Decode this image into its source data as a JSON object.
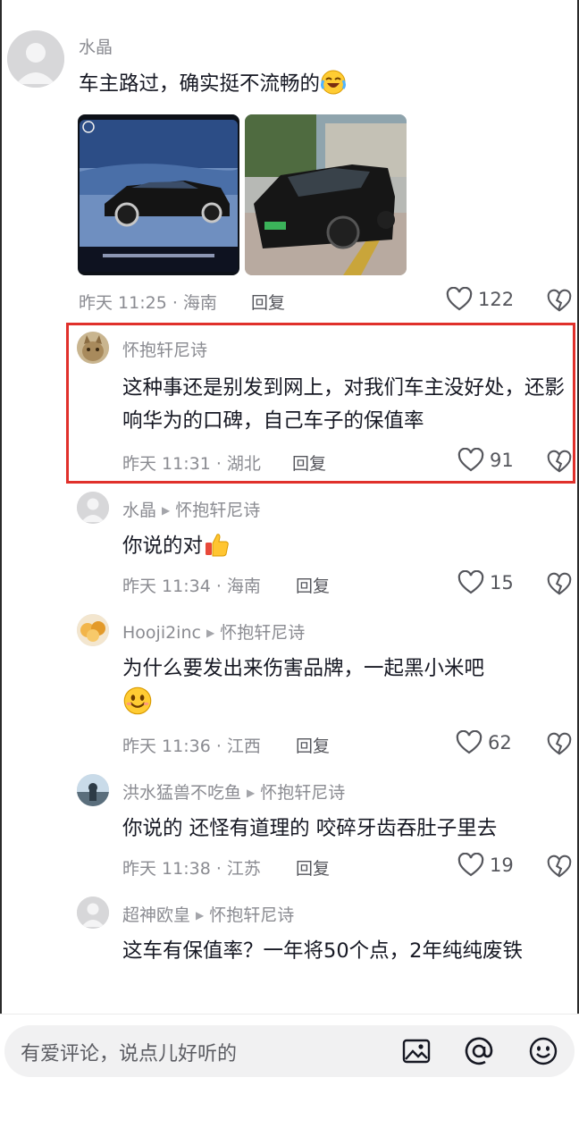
{
  "comments": [
    {
      "user": "水晶",
      "text": "车主路过，确实挺不流畅的",
      "meta": "昨天 11:25 · 海南",
      "reply": "回复",
      "likes": "122"
    },
    {
      "user": "怀抱轩尼诗",
      "text": "这种事还是别发到网上，对我们车主没好处，还影响华为的口碑，自己车子的保值率",
      "meta": "昨天 11:31 · 湖北",
      "reply": "回复",
      "likes": "91"
    },
    {
      "user": "水晶",
      "reply_to": "怀抱轩尼诗",
      "text": "你说的对",
      "meta": "昨天 11:34 · 海南",
      "reply": "回复",
      "likes": "15"
    },
    {
      "user": "Hooji2inc",
      "reply_to": "怀抱轩尼诗",
      "text": "为什么要发出来伤害品牌，一起黑小米吧",
      "meta": "昨天 11:36 · 江西",
      "reply": "回复",
      "likes": "62"
    },
    {
      "user": "洪水猛兽不吃鱼",
      "reply_to": "怀抱轩尼诗",
      "text": "你说的 还怪有道理的 咬碎牙齿吞肚子里去",
      "meta": "昨天 11:38 · 江苏",
      "reply": "回复",
      "likes": "19"
    },
    {
      "user": "超神欧皇",
      "reply_to": "怀抱轩尼诗",
      "text": "这车有保值率？一年将50个点，2年纯纯废铁"
    }
  ],
  "input": {
    "placeholder": "有爱评论，说点儿好听的"
  },
  "icons": {
    "image": "image-icon",
    "mention": "at-icon",
    "emoji": "emoji-icon",
    "like": "heart-icon",
    "dislike": "broken-heart-icon"
  },
  "colors": {
    "highlight": "#e0302b",
    "meta": "#8a8b91",
    "text": "#161823"
  }
}
